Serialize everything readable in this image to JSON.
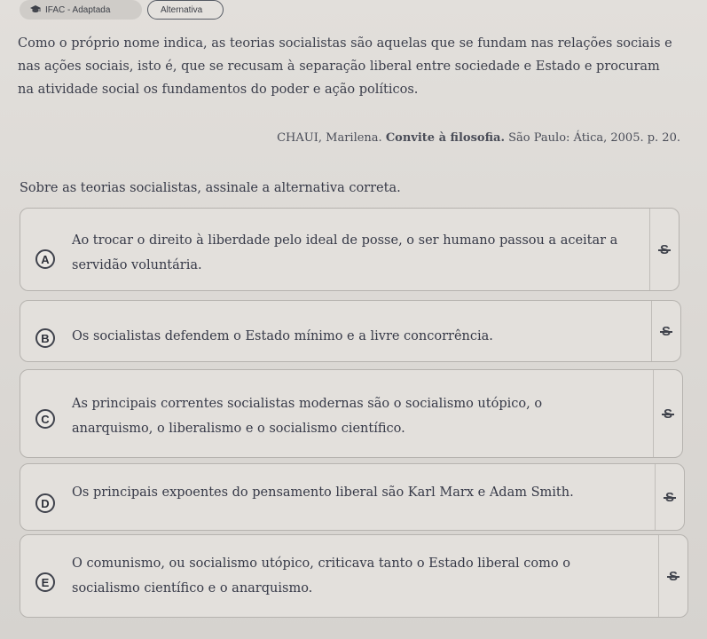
{
  "header": {
    "source_label": "IFAC - Adaptada",
    "type_label": "Alternativa",
    "source_icon": "graduation-cap-icon"
  },
  "question": {
    "text": "Como o próprio nome indica, as teorias socialistas são aquelas que se fundam nas relações sociais e nas ações sociais, isto é, que se recusam à separação liberal entre sociedade e Estado e procuram na atividade social os fundamentos do poder e ação políticos.",
    "citation_author": "CHAUI, Marilena.",
    "citation_work": "Convite à filosofia.",
    "citation_publisher": "São Paulo: Ática, 2005. p. 20.",
    "instruction": "Sobre as teorias socialistas, assinale a alternativa correta."
  },
  "options": [
    {
      "letter": "A",
      "text": "Ao trocar o direito à liberdade pelo ideal de posse, o ser humano passou a aceitar a servidão voluntária."
    },
    {
      "letter": "B",
      "text": "Os socialistas defendem o Estado mínimo e a livre concorrência."
    },
    {
      "letter": "C",
      "text": "As principais correntes socialistas modernas são o socialismo utópico, o anarquismo, o liberalismo e o socialismo científico."
    },
    {
      "letter": "D",
      "text": "Os principais expoentes do pensamento liberal são Karl Marx e Adam Smith."
    },
    {
      "letter": "E",
      "text": "O comunismo, ou socialismo utópico, criticava tanto o Estado liberal como o socialismo científico e o anarquismo."
    }
  ],
  "strike_glyph": "S",
  "strike_icon": "strikethrough-icon",
  "colors": {
    "background": "#dcd9d5",
    "text": "#3a3d4a",
    "border": "#b6b3af"
  }
}
